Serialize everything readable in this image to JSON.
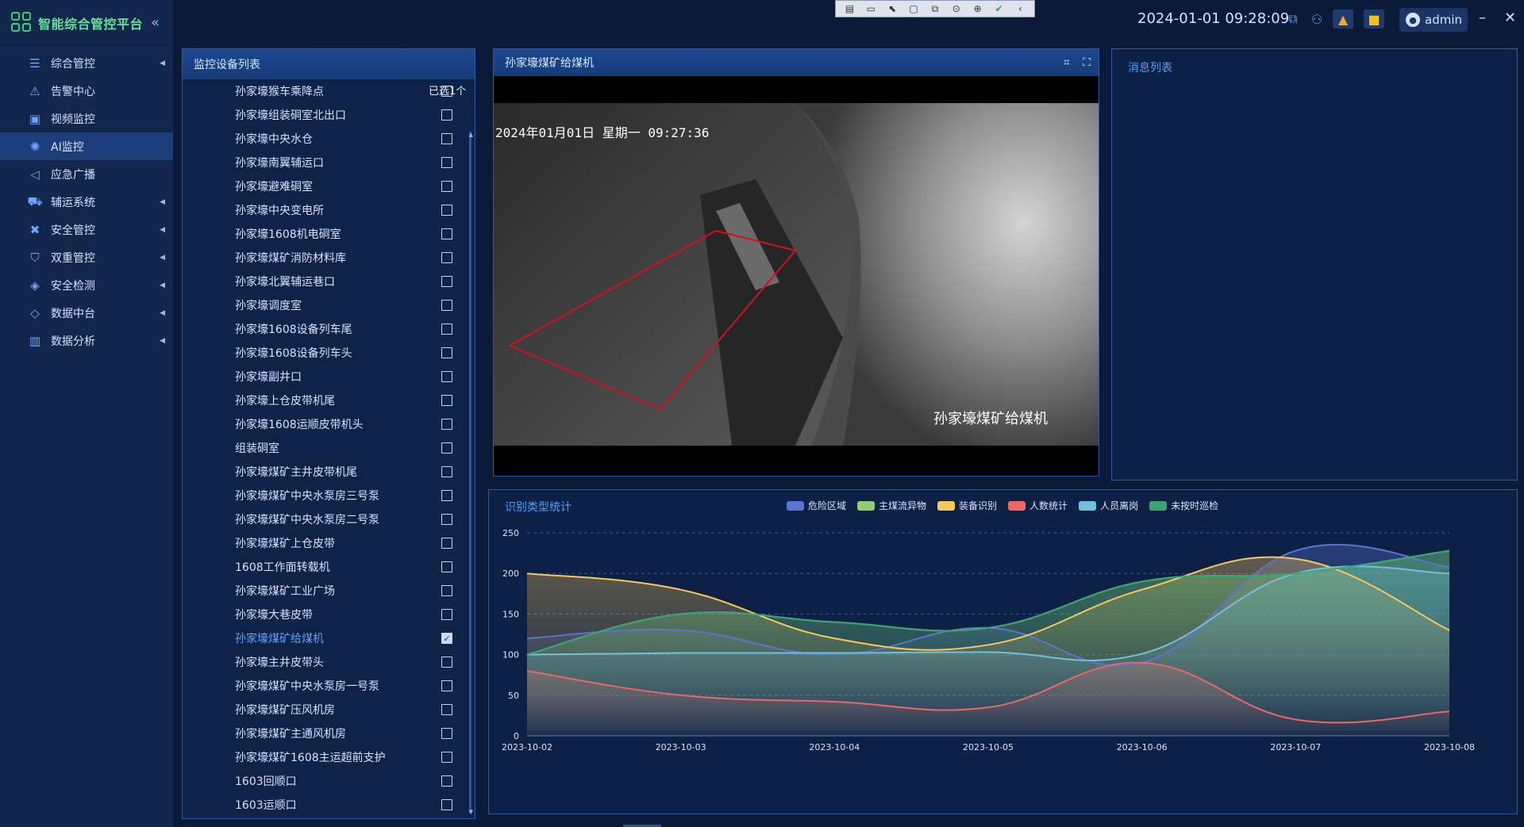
{
  "app": {
    "title": "智能综合管控平台",
    "collapse_icon": "double-chevron-left-icon"
  },
  "sidebar": {
    "items": [
      {
        "label": "综合管控",
        "icon": "sliders-icon",
        "has_arrow": true
      },
      {
        "label": "告警中心",
        "icon": "alarm-icon",
        "has_arrow": false
      },
      {
        "label": "视频监控",
        "icon": "video-icon",
        "has_arrow": false
      },
      {
        "label": "AI监控",
        "icon": "ai-brain-icon",
        "has_arrow": false,
        "active": true
      },
      {
        "label": "应急广播",
        "icon": "speaker-icon",
        "has_arrow": false
      },
      {
        "label": "辅运系统",
        "icon": "vehicle-icon",
        "has_arrow": true
      },
      {
        "label": "安全管控",
        "icon": "shield-cross-icon",
        "has_arrow": true
      },
      {
        "label": "双重管控",
        "icon": "shield-icon",
        "has_arrow": true
      },
      {
        "label": "安全检测",
        "icon": "shield-check-icon",
        "has_arrow": true
      },
      {
        "label": "数据中台",
        "icon": "data-shield-icon",
        "has_arrow": true
      },
      {
        "label": "数据分析",
        "icon": "chart-icon",
        "has_arrow": true
      }
    ]
  },
  "header": {
    "datetime": "2024-01-01 09:28:09",
    "user": "admin",
    "icons": [
      "network-icon",
      "tree-icon",
      "bell-icon",
      "message-icon"
    ]
  },
  "device_panel": {
    "title": "监控设备列表",
    "selected_label": "已选1个",
    "devices": [
      {
        "name": "孙家壕猴车乘降点",
        "checked": false
      },
      {
        "name": "孙家壕组装硐室北出口",
        "checked": false
      },
      {
        "name": "孙家壕中央水仓",
        "checked": false
      },
      {
        "name": "孙家壕南翼辅运口",
        "checked": false
      },
      {
        "name": "孙家壕避难硐室",
        "checked": false
      },
      {
        "name": "孙家壕中央变电所",
        "checked": false
      },
      {
        "name": "孙家壕1608机电硐室",
        "checked": false
      },
      {
        "name": "孙家壕煤矿消防材料库",
        "checked": false
      },
      {
        "name": "孙家壕北翼辅运巷口",
        "checked": false
      },
      {
        "name": "孙家壕调度室",
        "checked": false
      },
      {
        "name": "孙家壕1608设备列车尾",
        "checked": false
      },
      {
        "name": "孙家壕1608设备列车头",
        "checked": false
      },
      {
        "name": "孙家壕副井口",
        "checked": false
      },
      {
        "name": "孙家壕上仓皮带机尾",
        "checked": false
      },
      {
        "name": "孙家壕1608运顺皮带机头",
        "checked": false
      },
      {
        "name": "组装硐室",
        "checked": false
      },
      {
        "name": "孙家壕煤矿主井皮带机尾",
        "checked": false
      },
      {
        "name": "孙家壕煤矿中央水泵房三号泵",
        "checked": false
      },
      {
        "name": "孙家壕煤矿中央水泵房二号泵",
        "checked": false
      },
      {
        "name": "孙家壕煤矿上仓皮带",
        "checked": false
      },
      {
        "name": "1608工作面转载机",
        "checked": false
      },
      {
        "name": "孙家壕煤矿工业广场",
        "checked": false
      },
      {
        "name": "孙家壕大巷皮带",
        "checked": false
      },
      {
        "name": "孙家壕煤矿给煤机",
        "checked": true
      },
      {
        "name": "孙家壕主井皮带头",
        "checked": false
      },
      {
        "name": "孙家壕煤矿中央水泵房一号泵",
        "checked": false
      },
      {
        "name": "孙家壕煤矿压风机房",
        "checked": false
      },
      {
        "name": "孙家壕煤矿主通风机房",
        "checked": false
      },
      {
        "name": "孙家壕煤矿1608主运超前支护",
        "checked": false
      },
      {
        "name": "1603回顺口",
        "checked": false
      },
      {
        "name": "1603运顺口",
        "checked": false
      }
    ]
  },
  "video_panel": {
    "title": "孙家壕煤矿给煤机",
    "overlay_time": "2024年01月01日  星期一  09:27:36",
    "overlay_caption": "孙家壕煤矿给煤机",
    "detection_color": "#d4101a"
  },
  "message_panel": {
    "title": "消息列表"
  },
  "toolbar": {
    "icons": [
      "record-icon",
      "camera-icon",
      "cursor-icon",
      "frame-icon",
      "cursor-screen-icon",
      "mask-icon",
      "accessibility-icon",
      "check-icon",
      "chevron-left-icon"
    ]
  },
  "chart_data": {
    "type": "area",
    "title": "识别类型统计",
    "x": [
      "2023-10-02",
      "2023-10-03",
      "2023-10-04",
      "2023-10-05",
      "2023-10-06",
      "2023-10-07",
      "2023-10-08"
    ],
    "ylim": [
      0,
      250
    ],
    "yticks": [
      0,
      50,
      100,
      150,
      200,
      250
    ],
    "grid": true,
    "legend_position": "top",
    "series": [
      {
        "name": "危险区域",
        "color": "#5b73d2",
        "values": [
          120,
          130,
          100,
          133,
          90,
          228,
          208
        ]
      },
      {
        "name": "主煤流异物",
        "color": "#91cc75",
        "values": [
          100,
          150,
          140,
          133,
          190,
          200,
          228
        ]
      },
      {
        "name": "装备识别",
        "color": "#fac858",
        "values": [
          200,
          180,
          120,
          112,
          180,
          218,
          130
        ]
      },
      {
        "name": "人数统计",
        "color": "#ee6666",
        "values": [
          80,
          50,
          42,
          35,
          90,
          20,
          30
        ]
      },
      {
        "name": "人员离岗",
        "color": "#73c0de",
        "values": [
          100,
          102,
          102,
          103,
          101,
          200,
          200
        ]
      },
      {
        "name": "未按时巡检",
        "color": "#3ba272",
        "values": [
          100,
          150,
          140,
          133,
          190,
          200,
          228
        ]
      }
    ]
  }
}
